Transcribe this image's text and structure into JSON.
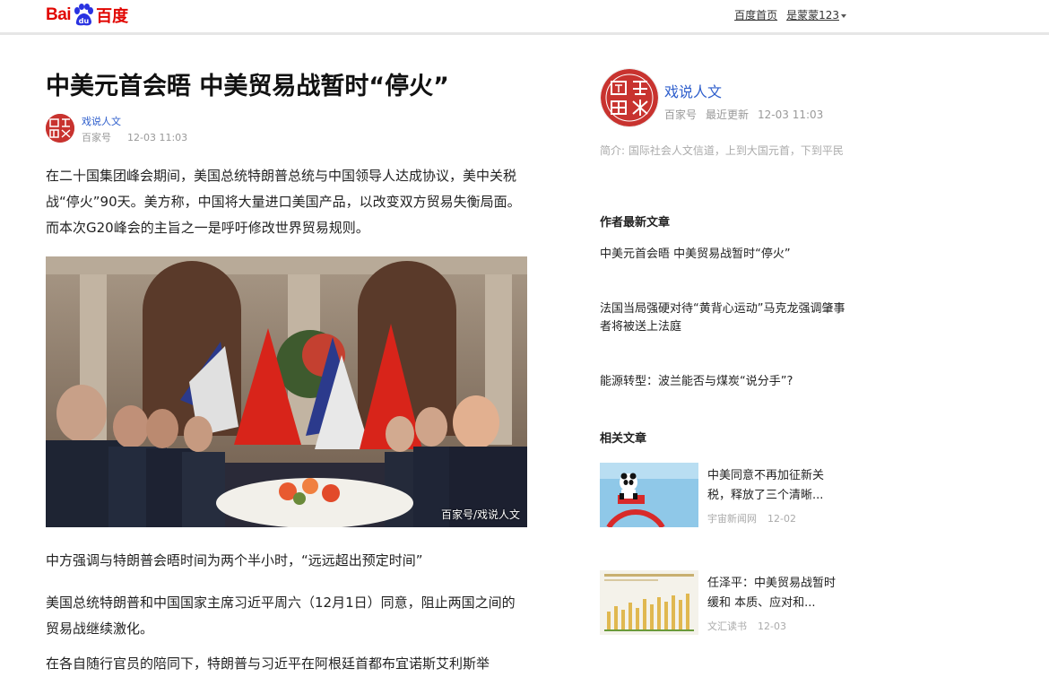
{
  "brand": {
    "logo_left": "Bai",
    "logo_right": "百度"
  },
  "topnav": {
    "home": "百度首页",
    "user": "是蒙蒙123"
  },
  "article": {
    "title": "中美元首会晤 中美贸易战暂时“停火”",
    "author": "戏说人文",
    "source": "百家号",
    "time": "12-03 11:03",
    "paragraphs": [
      "在二十国集团峰会期间，美国总统特朗普总统与中国领导人达成协议，美中关税战“停火”90天。美方称，中国将大量进口美国产品，以改变双方贸易失衡局面。而本次G20峰会的主旨之一是呼吁修改世界贸易规则。",
      "中方强调与特朗普会晤时间为两个半小时，“远远超出预定时间”",
      "美国总统特朗普和中国国家主席习近平周六（12月1日）同意，阻止两国之间的贸易战继续激化。",
      "在各自随行官员的陪同下，特朗普与习近平在阿根廷首都布宜诺斯艾利斯举"
    ],
    "photo_caption": "百家号/戏说人文"
  },
  "sidebar": {
    "author": "戏说人文",
    "source": "百家号",
    "latest": "最近更新",
    "time": "12-03 11:03",
    "bio": "简介: 国际社会人文信道，上到大国元首，下到平民",
    "latest_title": "作者最新文章",
    "latest_articles": [
      "中美元首会晤 中美贸易战暂时“停火”",
      "法国当局强硬对待“黄背心运动”马克龙强调肇事者将被送上法庭",
      "能源转型：波兰能否与煤炭“说分手”?"
    ],
    "related_title": "相关文章",
    "related": [
      {
        "title": "中美同意不再加征新关税，释放了三个清晰...",
        "source": "宇宙新闻网",
        "date": "12-02"
      },
      {
        "title": "任泽平：中美贸易战暂时缓和 本质、应对和...",
        "source": "文汇读书",
        "date": "12-03"
      }
    ]
  },
  "colors": {
    "brand_red": "#e10601",
    "link_blue": "#2f5fcc"
  }
}
